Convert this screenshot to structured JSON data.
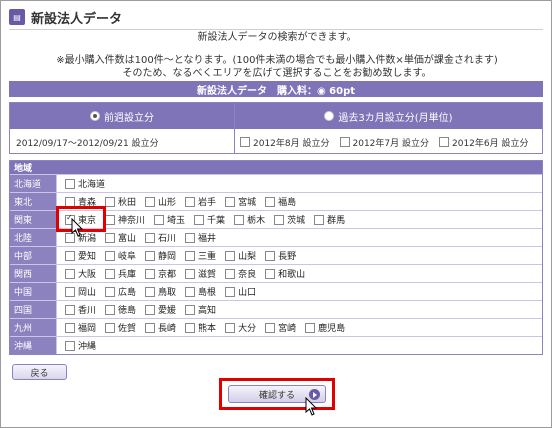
{
  "header": {
    "title": "新設法人データ",
    "icon": "document-icon"
  },
  "intro": {
    "line1": "新設法人データの検索ができます。",
    "line2": "※最小購入件数は100件〜となります。(100件未満の場合でも最小購入件数×単価が課金されます)",
    "line3": "そのため、なるべくエリアを広げて選択することをお勧め致します。"
  },
  "fee_bar": {
    "label": "新設法人データ　購入料：◉ 60pt"
  },
  "period": {
    "left_label": "前週設立分",
    "left_selected": true,
    "left_range": "2012/09/17〜2012/09/21 設立分",
    "right_label": "過去3カ月設立分(月単位)",
    "right_selected": false,
    "months": [
      "2012年8月 設立分",
      "2012年7月 設立分",
      "2012年6月 設立分"
    ]
  },
  "region": {
    "header": "地域",
    "rows": [
      {
        "name": "北海道",
        "prefs": [
          "北海道"
        ]
      },
      {
        "name": "東北",
        "prefs": [
          "青森",
          "秋田",
          "山形",
          "岩手",
          "宮城",
          "福島"
        ]
      },
      {
        "name": "関東",
        "prefs": [
          "東京",
          "神奈川",
          "埼玉",
          "千葉",
          "栃木",
          "茨城",
          "群馬"
        ],
        "checked": [
          "東京"
        ]
      },
      {
        "name": "北陸",
        "prefs": [
          "新潟",
          "富山",
          "石川",
          "福井"
        ]
      },
      {
        "name": "中部",
        "prefs": [
          "愛知",
          "岐阜",
          "静岡",
          "三重",
          "山梨",
          "長野"
        ]
      },
      {
        "name": "関西",
        "prefs": [
          "大阪",
          "兵庫",
          "京都",
          "滋賀",
          "奈良",
          "和歌山"
        ]
      },
      {
        "name": "中国",
        "prefs": [
          "岡山",
          "広島",
          "鳥取",
          "島根",
          "山口"
        ]
      },
      {
        "name": "四国",
        "prefs": [
          "香川",
          "徳島",
          "愛媛",
          "高知"
        ]
      },
      {
        "name": "九州",
        "prefs": [
          "福岡",
          "佐賀",
          "長崎",
          "熊本",
          "大分",
          "宮崎",
          "鹿児島"
        ]
      },
      {
        "name": "沖縄",
        "prefs": [
          "沖縄"
        ]
      }
    ]
  },
  "buttons": {
    "back": "戻る",
    "confirm": "確認する"
  },
  "colors": {
    "accent": "#7f74b8",
    "highlight": "#e00000"
  }
}
